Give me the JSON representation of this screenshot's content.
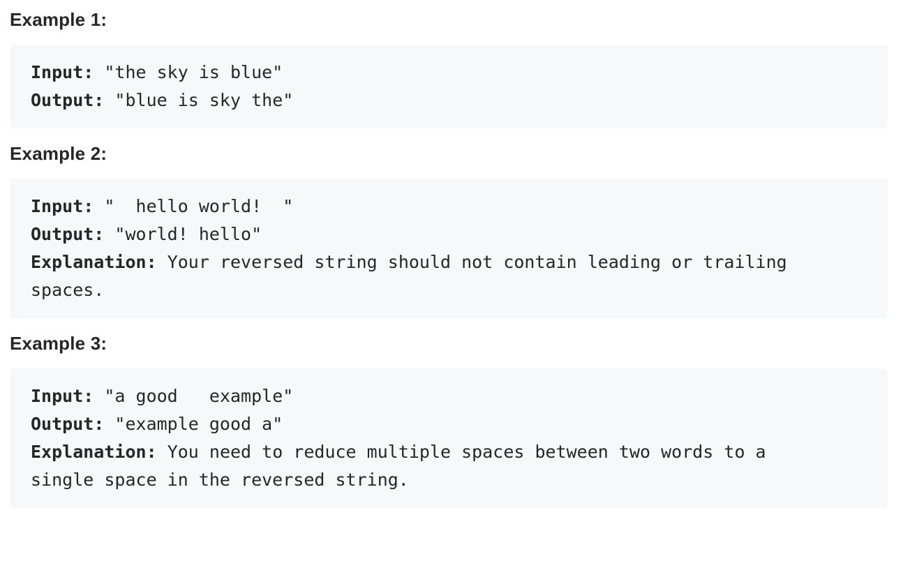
{
  "examples": [
    {
      "heading": "Example 1:",
      "input_label": "Input:",
      "input_value": "\"the sky is blue\"",
      "output_label": "Output:",
      "output_value": "\"blue is sky the\""
    },
    {
      "heading": "Example 2:",
      "input_label": "Input:",
      "input_value": "\"  hello world!  \"",
      "output_label": "Output:",
      "output_value": "\"world! hello\"",
      "explanation_label": "Explanation:",
      "explanation_line1": "Your reversed string should not contain leading or trailing",
      "explanation_line2": "spaces."
    },
    {
      "heading": "Example 3:",
      "input_label": "Input:",
      "input_value": "\"a good   example\"",
      "output_label": "Output:",
      "output_value": "\"example good a\"",
      "explanation_label": "Explanation:",
      "explanation_line1": "You need to reduce multiple spaces between two words to a",
      "explanation_line2": "single space in the reversed string."
    }
  ]
}
